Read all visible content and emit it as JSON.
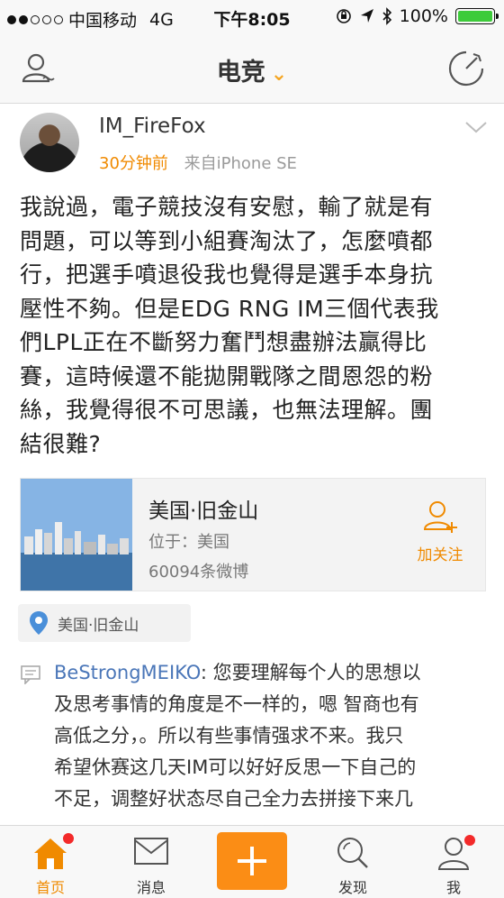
{
  "status_bar": {
    "carrier": "中国移动",
    "network": "4G",
    "time": "下午8:05",
    "battery": "100%",
    "battery_level": 1.0
  },
  "nav": {
    "title": "电竞",
    "accent_color": "#f5a623"
  },
  "post": {
    "username": "IM_FireFox",
    "time_ago": "30分钟前",
    "source": "来自iPhone SE",
    "body_lines": [
      "我說過，電子競技沒有安慰，輸了就是有",
      "問題，可以等到小組賽淘汰了，怎麼噴都",
      "行，把選手噴退役我也覺得是選手本身抗",
      "壓性不夠。但是EDG RNG IM三個代表我",
      "們LPL正在不斷努力奮鬥想盡辦法贏得比",
      "賽，這時候還不能拋開戰隊之間恩怨的粉",
      "絲，我覺得很不可思議，也無法理解。團",
      "結很難?"
    ]
  },
  "location_card": {
    "name": "美国·旧金山",
    "country": "位于：美国",
    "post_count": "60094条微博",
    "follow_label": "加关注"
  },
  "location_tag": {
    "label": "美国·旧金山"
  },
  "comment": {
    "author": "BeStrongMEIKO",
    "text_lines": [
      ": 您要理解每个人的思想以",
      "及思考事情的角度是不一样的，嗯 智商也有",
      "高低之分，。所以有些事情强求不来。我只",
      "希望休赛这几天IM可以好好反思一下自己的",
      "不足，调整好状态尽自己全力去拼接下来几"
    ]
  },
  "tab_bar": {
    "home": "首页",
    "messages": "消息",
    "discover": "发现",
    "me": "我",
    "accent_color": "#f08a00",
    "badge_color": "#f32a2a"
  }
}
